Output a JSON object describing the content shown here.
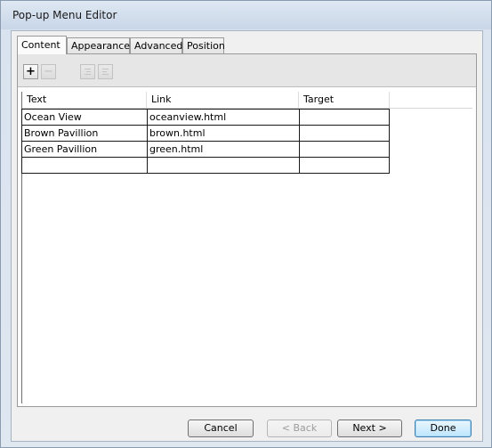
{
  "window": {
    "title": "Pop-up Menu Editor"
  },
  "tabs": [
    {
      "label": "Content",
      "active": true
    },
    {
      "label": "Appearance",
      "active": false
    },
    {
      "label": "Advanced",
      "active": false
    },
    {
      "label": "Position",
      "active": false
    }
  ],
  "toolbar": {
    "add_label": "+",
    "remove_label": "−",
    "icons": [
      "add-item-icon",
      "remove-item-icon",
      "outdent-icon",
      "indent-icon"
    ]
  },
  "table": {
    "columns": [
      "Text",
      "Link",
      "Target"
    ],
    "rows": [
      [
        "Ocean View",
        "oceanview.html",
        ""
      ],
      [
        "Brown Pavillion",
        "brown.html",
        ""
      ],
      [
        "Green Pavillion",
        "green.html",
        ""
      ],
      [
        "",
        "",
        ""
      ]
    ]
  },
  "buttons": {
    "cancel": "Cancel",
    "back": "< Back",
    "next": "Next >",
    "done": "Done"
  },
  "colors": {
    "default_button": "#bee6fd",
    "title_bar": "#c8d6e8"
  }
}
